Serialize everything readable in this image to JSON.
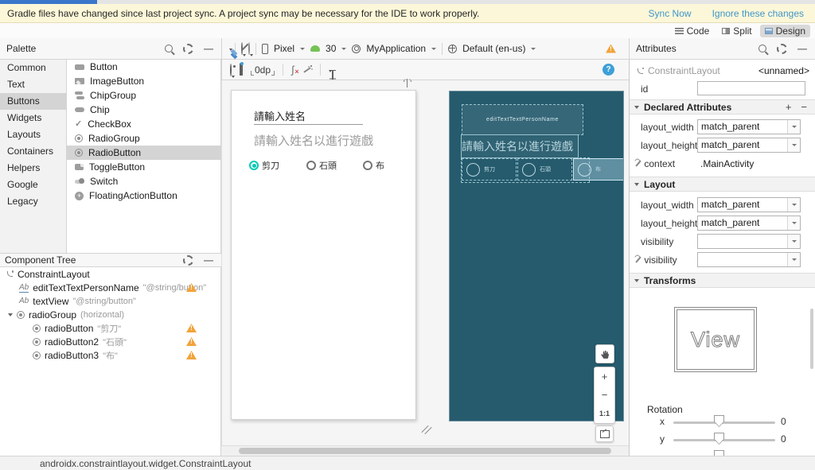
{
  "notification": {
    "message": "Gradle files have changed since last project sync. A project sync may be necessary for the IDE to work properly.",
    "sync_now": "Sync Now",
    "ignore": "Ignore these changes"
  },
  "view_modes": {
    "code": "Code",
    "split": "Split",
    "design": "Design"
  },
  "palette": {
    "title": "Palette",
    "categories": [
      "Common",
      "Text",
      "Buttons",
      "Widgets",
      "Layouts",
      "Containers",
      "Helpers",
      "Google",
      "Legacy"
    ],
    "items": [
      "Button",
      "ImageButton",
      "ChipGroup",
      "Chip",
      "CheckBox",
      "RadioGroup",
      "RadioButton",
      "ToggleButton",
      "Switch",
      "FloatingActionButton"
    ]
  },
  "design_toolbar": {
    "device": "Pixel",
    "api_level": "30",
    "module": "MyApplication",
    "locale": "Default (en-us)",
    "margin": "0dp"
  },
  "component_tree": {
    "title": "Component Tree",
    "nodes": [
      {
        "label": "ConstraintLayout",
        "value": ""
      },
      {
        "label": "editTextTextPersonName",
        "value": "\"@string/button\""
      },
      {
        "label": "textView",
        "value": "\"@string/button\""
      },
      {
        "label": "radioGroup",
        "value": "(horizontal)"
      },
      {
        "label": "radioButton",
        "value": "\"剪刀\""
      },
      {
        "label": "radioButton2",
        "value": "\"石頭\""
      },
      {
        "label": "radioButton3",
        "value": "\"布\""
      }
    ]
  },
  "canvas": {
    "edittext_text": "請輸入姓名",
    "textview_text": "請輸入姓名以進行遊戲",
    "radio_labels": [
      "剪刀",
      "石頭",
      "布"
    ]
  },
  "blueprint": {
    "edittext_id": "editTextTextPersonName",
    "textview_text": "請輸入姓名以進行遊戲",
    "radio_labels": [
      "剪刀",
      "石頭",
      "布"
    ]
  },
  "zoom_controls": {
    "zoom_in": "+",
    "zoom_out": "−",
    "one_to_one": "1:1"
  },
  "attributes": {
    "title": "Attributes",
    "component": "ConstraintLayout",
    "name": "<unnamed>",
    "id_label": "id",
    "id_value": "",
    "declared": {
      "title": "Declared Attributes",
      "add": "+",
      "remove": "−",
      "rows": [
        {
          "name": "layout_width",
          "value": "match_parent"
        },
        {
          "name": "layout_height",
          "value": "match_parent"
        },
        {
          "name": "context",
          "value": ".MainActivity"
        }
      ]
    },
    "layout": {
      "title": "Layout",
      "rows": [
        {
          "name": "layout_width",
          "value": "match_parent"
        },
        {
          "name": "layout_height",
          "value": "match_parent"
        },
        {
          "name": "visibility",
          "value": ""
        },
        {
          "name": "visibility",
          "value": ""
        }
      ]
    },
    "transforms": {
      "title": "Transforms",
      "preview_label": "View"
    },
    "rotation": {
      "title": "Rotation",
      "sliders": [
        {
          "axis": "x",
          "value": "0"
        },
        {
          "axis": "y",
          "value": "0"
        }
      ]
    }
  },
  "icons": {
    "help": "?",
    "ab": "Ab",
    "fab_plus": "+",
    "check": "✓",
    "clear_constraints": "∫"
  },
  "status_bar": "androidx.constraintlayout.widget.ConstraintLayout"
}
